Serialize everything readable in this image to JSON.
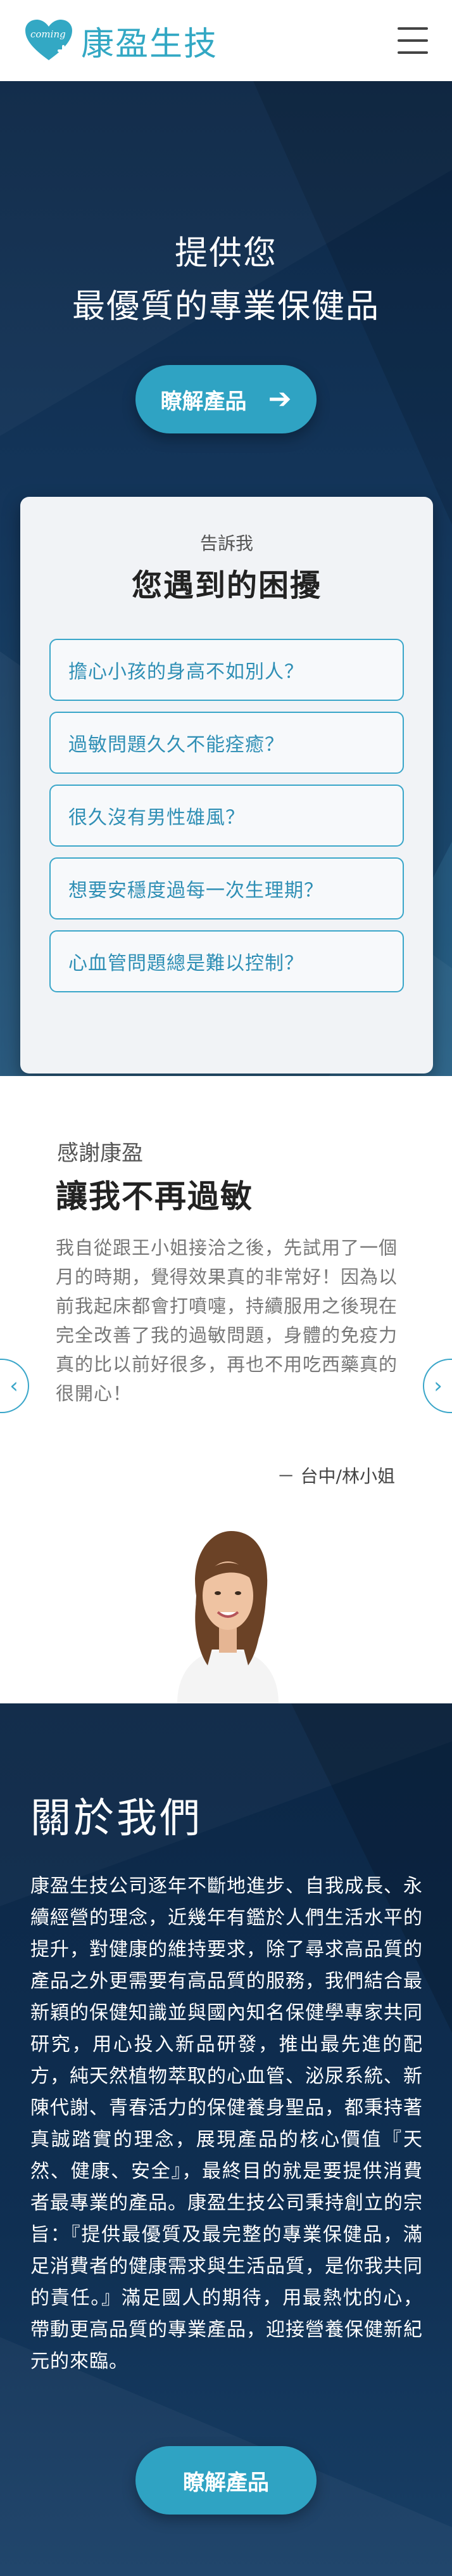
{
  "header": {
    "brand_name": "康盈生技",
    "logo_script": "coming",
    "colors": {
      "brand": "#33a8c4"
    }
  },
  "hero": {
    "title_line1": "提供您",
    "title_line2": "最優質的專業保健品",
    "cta_label": "瞭解產品",
    "cta_icon": "arrow-right-icon",
    "colors": {
      "background": "#0c2746",
      "button": "#2fa3c3"
    }
  },
  "concerns": {
    "kicker": "告訴我",
    "heading": "您遇到的困擾",
    "items": [
      {
        "label": "擔心小孩的身高不如別人？"
      },
      {
        "label": "過敏問題久久不能痊癒？"
      },
      {
        "label": "很久沒有男性雄風？"
      },
      {
        "label": "想要安穩度過每一次生理期？"
      },
      {
        "label": "心血管問題總是難以控制？"
      }
    ],
    "colors": {
      "item_border": "#3aa6c9",
      "item_text": "#2f8fb5"
    }
  },
  "testimonial": {
    "kicker": "感謝康盈",
    "title": "讓我不再過敏",
    "body": "我自從跟王小姐接洽之後，先試用了一個月的時期，覺得效果真的非常好！因為以前我起床都會打噴嚏，持續服用之後現在完全改善了我的過敏問題，身體的免疫力真的比以前好很多，再也不用吃西藥真的很開心！",
    "author": "－ 台中/林小姐",
    "prev_icon": "chevron-left-icon",
    "next_icon": "chevron-right-icon",
    "prev_glyph": "‹",
    "next_glyph": "›"
  },
  "about": {
    "title": "關於我們",
    "body": "康盈生技公司逐年不斷地進步、自我成長、永續經營的理念，近幾年有鑑於人們生活水平的提升，對健康的維持要求，除了尋求高品質的產品之外更需要有高品質的服務，我們結合最新穎的保健知識並與國內知名保健學專家共同研究，用心投入新品研發，推出最先進的配方，純天然植物萃取的心血管、泌尿系統、新陳代謝、青春活力的保健養身聖品，都秉持著真誠踏實的理念，展現產品的核心價值『天然、健康、安全』，最終目的就是要提供消費者最專業的產品。康盈生技公司秉持創立的宗旨：『提供最優質及最完整的專業保健品，滿足消費者的健康需求與生活品質，是你我共同的責任。』滿足國人的期待，用最熱忱的心，帶動更高品質的專業產品，迎接營養保健新紀元的來臨。",
    "cta_label": "瞭解產品"
  }
}
